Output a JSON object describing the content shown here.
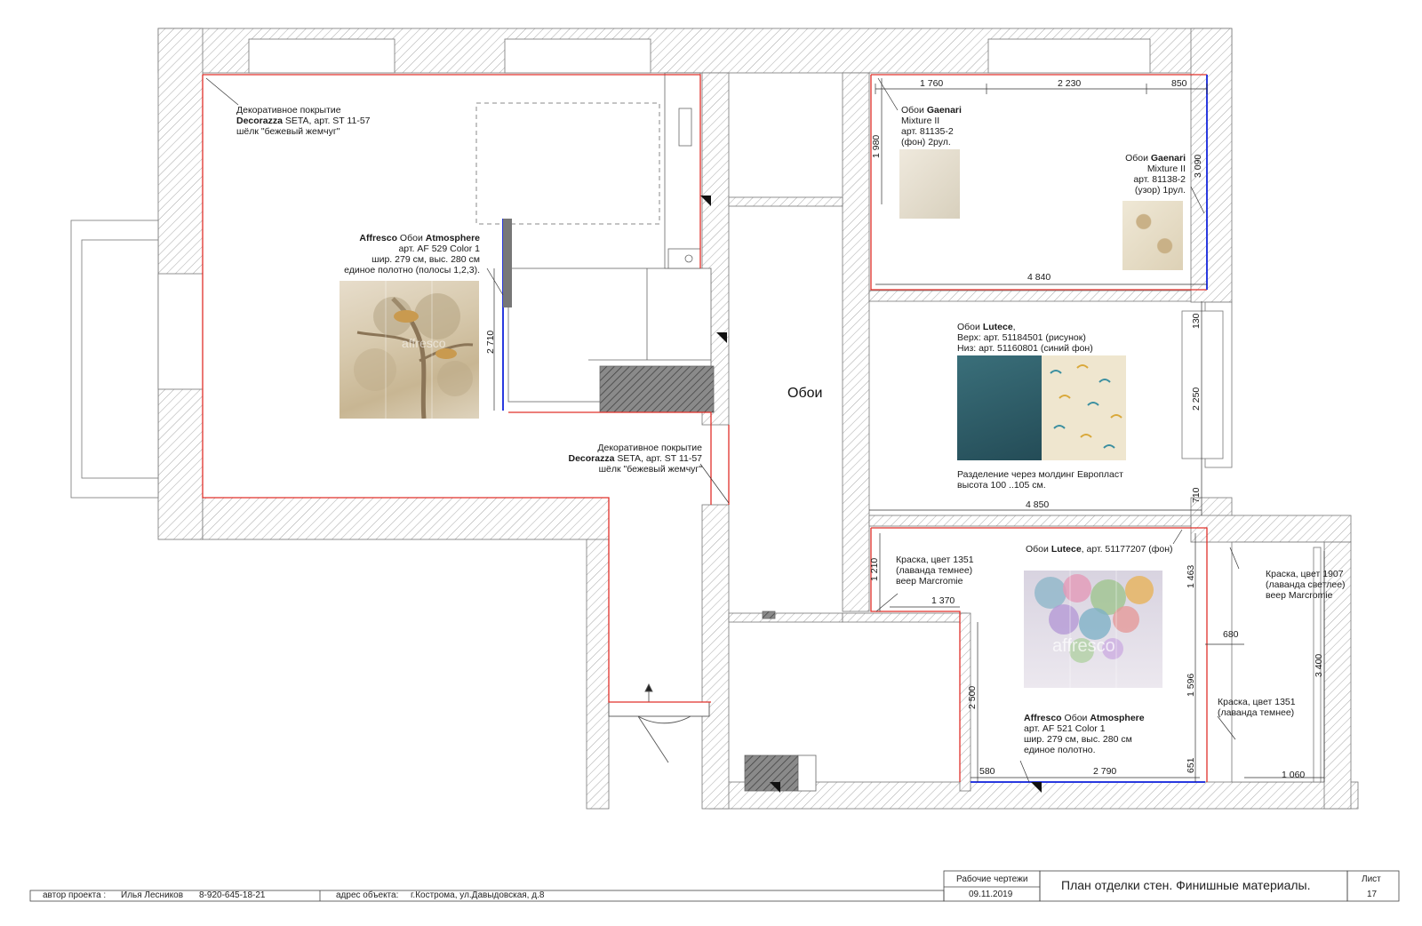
{
  "plan": {
    "room_label_center": "Обои"
  },
  "notes": {
    "deco_top": {
      "l1": "Декоративное покрытие",
      "brand": "Decorazza",
      "l2rest": " SETA, арт. ST 11-57",
      "l3": "шёлк \"бежевый жемчуг\""
    },
    "affresco_left": {
      "brand": "Affresco",
      "mid": " Обои ",
      "name": "Atmosphere",
      "l2": "арт. AF 529 Color 1",
      "l3": "шир. 279 см, выс. 280 см",
      "l4": "единое полотно (полосы 1,2,3)."
    },
    "deco_mid": {
      "l1": "Декоративное покрытие",
      "brand": "Decorazza",
      "l2rest": " SETA, арт. ST 11-57",
      "l3": "шёлк \"бежевый жемчуг\""
    },
    "gaenari_1": {
      "pre": "Обои ",
      "brand": "Gaenari",
      "l2": "Mixture II",
      "l3": "арт. 81135-2",
      "l4": "(фон) 2рул."
    },
    "gaenari_2": {
      "pre": "Обои ",
      "brand": "Gaenari",
      "l2": "Mixture II",
      "l3": "арт. 81138-2",
      "l4": "(узор) 1рул."
    },
    "lutece_1": {
      "pre": "Обои ",
      "brand": "Lutece",
      "post": ",",
      "l2": "Верх: арт. 51184501 (рисунок)",
      "l3": "Низ: арт. 51160801 (синий фон)"
    },
    "molding": {
      "l1": "Разделение через молдинг Европласт",
      "l2": "высота 100 ..105 см."
    },
    "lutece_2": {
      "pre": "Обои ",
      "brand": "Lutece",
      "post": ", арт. 51177207 (фон)"
    },
    "paint_1": {
      "l1": "Краска, цвет 1351",
      "l2": "(лаванда темнее)",
      "l3": "веер Marcromie"
    },
    "paint_2": {
      "l1": "Краска, цвет 1907",
      "l2": "(лаванда светлее)",
      "l3": "веер Marcromie"
    },
    "paint_3": {
      "l1": "Краска, цвет 1351",
      "l2": "(лаванда темнее)"
    },
    "affresco_right": {
      "brand": "Affresco",
      "mid": " Обои ",
      "name": "Atmosphere",
      "l2": "арт. AF 521 Color 1",
      "l3": "шир. 279 см, выс. 280 см",
      "l4": "единое полотно."
    },
    "watermark": "affresco"
  },
  "dimensions": {
    "d1760": "1 760",
    "d2230": "2 230",
    "d850": "850",
    "d1980": "1 980",
    "d3090": "3 090",
    "d4840": "4 840",
    "d2710": "2 710",
    "d130": "130",
    "d2250": "2 250",
    "d710": "710",
    "d4850": "4 850",
    "d1210": "1 210",
    "d1370": "1 370",
    "d1463": "1 463",
    "d680": "680",
    "d3400": "3 400",
    "d2500": "2 500",
    "d1596": "1 596",
    "d580": "580",
    "d2790": "2 790",
    "d651": "651",
    "d1060": "1 060"
  },
  "title_block": {
    "author_label": "автор проекта :",
    "author_name": "Илья Лесников",
    "author_phone": "8-920-645-18-21",
    "address_label": "адрес объекта:",
    "address_value": "г.Кострома, ул.Давыдовская, д.8",
    "stage": "Рабочие чертежи",
    "date": "09.11.2019",
    "title": "План отделки стен. Финишные материалы.",
    "sheet_label": "Лист",
    "sheet_number": "17"
  },
  "colors": {
    "wall_red": "#e0302a",
    "wall_blue": "#2a3adf",
    "hatch": "#9a9a9a",
    "teal": "#2c5a66"
  }
}
